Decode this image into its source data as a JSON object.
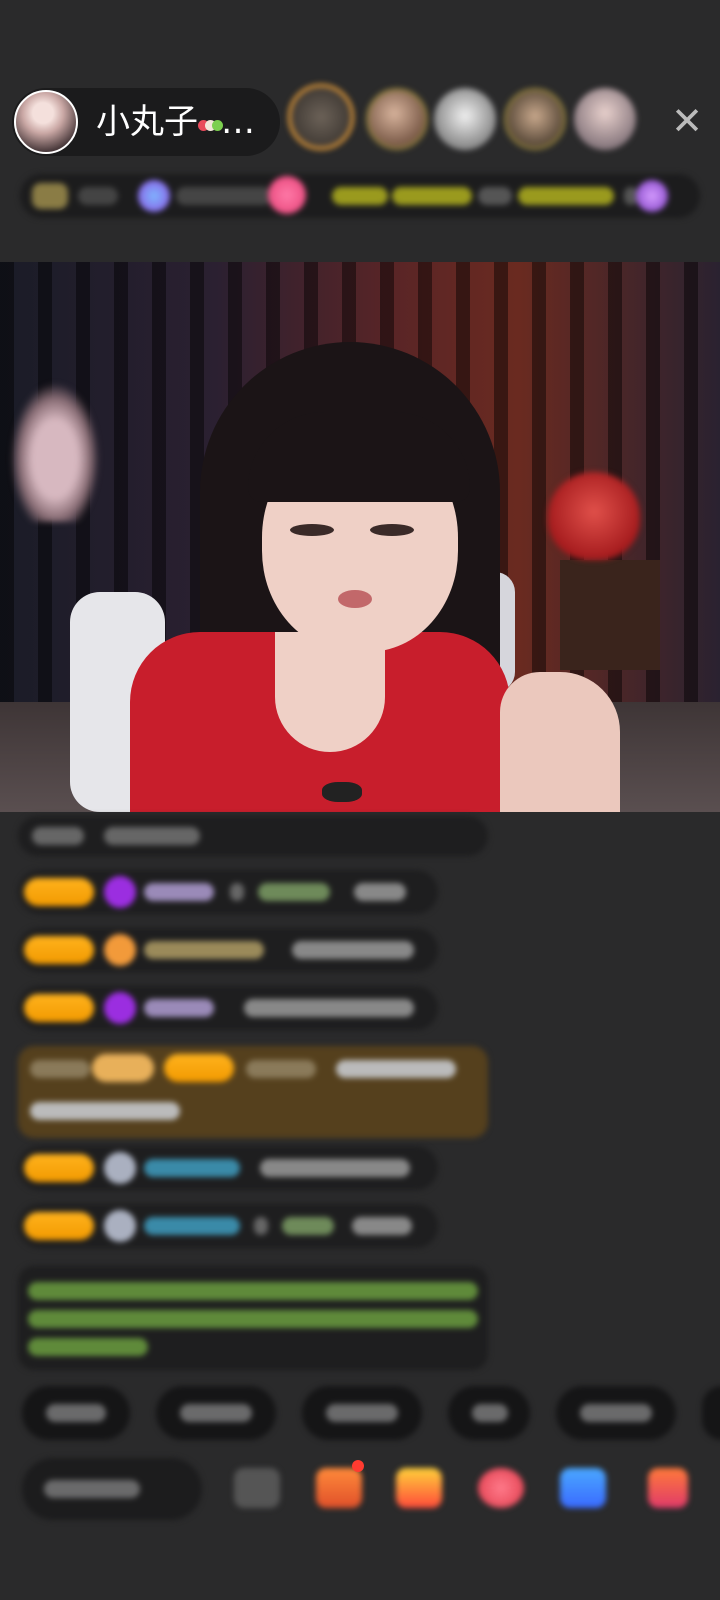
{
  "header": {
    "host_name": "小丸子",
    "ellipsis": "…",
    "close_glyph": "✕"
  },
  "colors": {
    "badge": "#f5a10a",
    "gem_purple": "#9b2ee0",
    "gold_msg_bg": "#55401d",
    "live_bg": "#2a2a2b"
  }
}
